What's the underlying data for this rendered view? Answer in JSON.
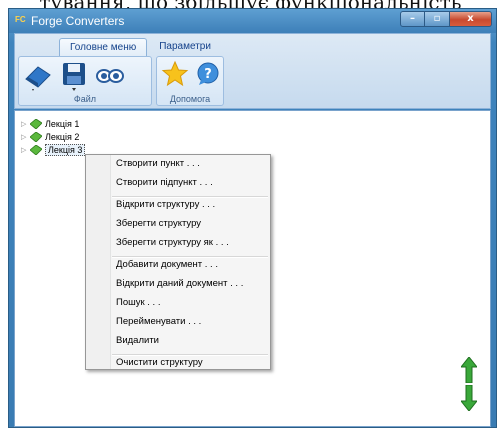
{
  "caption": "тування, що збільшує функціональність",
  "window": {
    "title": "Forge Converters",
    "badge": "FC"
  },
  "ribbon": {
    "tabs": [
      "Головне меню",
      "Параметри"
    ],
    "groups": {
      "file_label": "Файл",
      "help_label": "Допомога"
    }
  },
  "tree": {
    "items": [
      "Лекція 1",
      "Лекція 2",
      "Лекція 3"
    ]
  },
  "context_menu": {
    "group1": [
      "Створити пункт . . .",
      "Створити підпункт . . ."
    ],
    "group2": [
      "Відкрити структуру . . .",
      "Зберегти структуру",
      "Зберегти структуру як . . ."
    ],
    "group3": [
      "Добавити документ . . .",
      "Відкрити даний документ . . .",
      "Пошук . . .",
      "Перейменувати . . .",
      "Видалити"
    ],
    "group4": [
      "Очистити структуру"
    ]
  },
  "colors": {
    "accent": "#3f84bd",
    "arrow_green": "#3aa83a"
  },
  "icons": [
    "eraser-icon",
    "save-icon",
    "view-icon",
    "star-icon",
    "help-icon",
    "arrow-up-icon",
    "arrow-down-icon",
    "book-icon"
  ]
}
